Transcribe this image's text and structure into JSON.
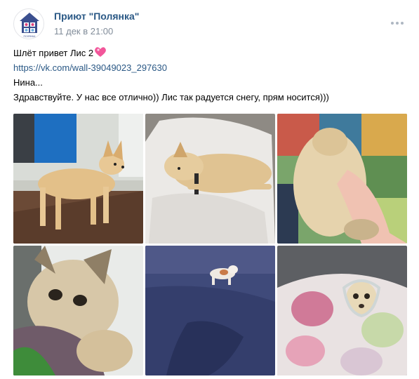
{
  "post": {
    "author": "Приют \"Полянка\"",
    "date": "11 дек в 21:00",
    "lines": [
      "Шлёт привет Лис 2",
      "https://vk.com/wall-39049023_297630",
      "Нина...",
      "Здравствуйте. У нас все отлично)) Лис так радуется снегу, прям носится)))"
    ],
    "avatar_icon": "shelter-house-logo-icon",
    "avatar_caption": "ПОЛЯНКА",
    "emoji_icon": "sparkling-heart-icon"
  },
  "photos": [
    {
      "name": "dog-standing-photo"
    },
    {
      "name": "dog-lying-on-sheet-photo"
    },
    {
      "name": "dog-on-blanket-photo"
    },
    {
      "name": "dog-closeup-photo"
    },
    {
      "name": "dog-running-in-snow-photo"
    },
    {
      "name": "dog-wrapped-in-blanket-photo"
    }
  ],
  "colors": {
    "author": "#2a5885",
    "date": "#818c99",
    "link": "#2a5885"
  }
}
